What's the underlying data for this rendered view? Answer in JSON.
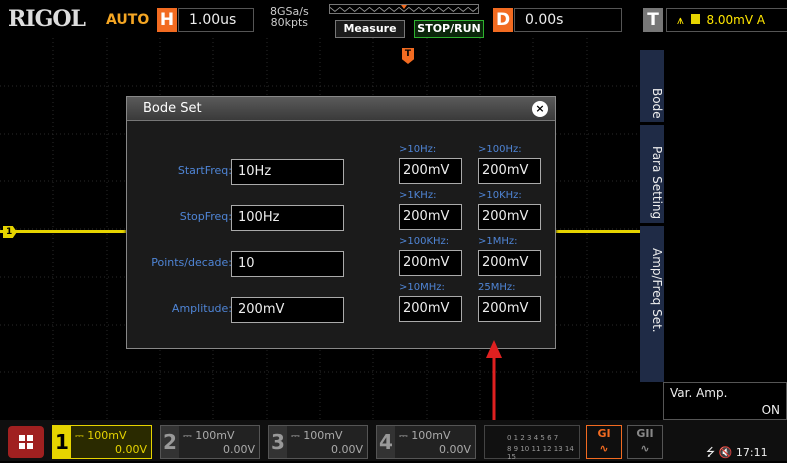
{
  "topbar": {
    "brand": "RIGOL",
    "mode": "AUTO",
    "h_label": "H",
    "h_value": "1.00us",
    "sample_rate": "8GSa/s",
    "memory_depth": "80kpts",
    "measure": "Measure",
    "stop_run": "STOP/RUN",
    "d_label": "D",
    "d_value": "0.00s",
    "t_label": "T",
    "trigger_value": "8.00mV",
    "trigger_suffix": "A"
  },
  "waveform": {
    "ch1_marker": "1",
    "trigger_marker": "T"
  },
  "dialog": {
    "title": "Bode Set",
    "close": "×",
    "fields": [
      {
        "label": "StartFreq:",
        "value": "10Hz"
      },
      {
        "label": "StopFreq:",
        "value": "100Hz"
      },
      {
        "label": "Points/decade:",
        "value": "10"
      },
      {
        "label": "Amplitude:",
        "value": "200mV"
      }
    ],
    "freq_amps": [
      {
        "label": ">10Hz:",
        "value": "200mV"
      },
      {
        "label": ">100Hz:",
        "value": "200mV"
      },
      {
        "label": ">1KHz:",
        "value": "200mV"
      },
      {
        "label": ">10KHz:",
        "value": "200mV"
      },
      {
        "label": ">100KHz:",
        "value": "200mV"
      },
      {
        "label": ">1MHz:",
        "value": "200mV"
      },
      {
        "label": ">10MHz:",
        "value": "200mV"
      },
      {
        "label": "25MHz:",
        "value": "200mV"
      }
    ]
  },
  "side_menu": {
    "tabs": [
      "Bode",
      "Para Setting",
      "Amp/Freq Set."
    ],
    "var_amp_label": "Var. Amp.",
    "var_amp_value": "ON"
  },
  "bottom": {
    "channels": [
      {
        "num": "1",
        "scale": "100mV",
        "offset": "0.00V"
      },
      {
        "num": "2",
        "scale": "100mV",
        "offset": "0.00V"
      },
      {
        "num": "3",
        "scale": "100mV",
        "offset": "0.00V"
      },
      {
        "num": "4",
        "scale": "100mV",
        "offset": "0.00V"
      }
    ],
    "logic_row1": "0 1 2 3 4 5 6 7",
    "logic_row2": "8 9 10 11 12 13 14 15",
    "g1": "GI",
    "g2": "GII",
    "time": "17:11"
  },
  "colors": {
    "ch1": "#e6d400",
    "ch2": "#00c8ff",
    "ch3": "#ff4fc8",
    "ch4": "#2f7cff",
    "accent": "#f26b21",
    "arrow": "#e02020",
    "label_blue": "#4f85d6"
  }
}
